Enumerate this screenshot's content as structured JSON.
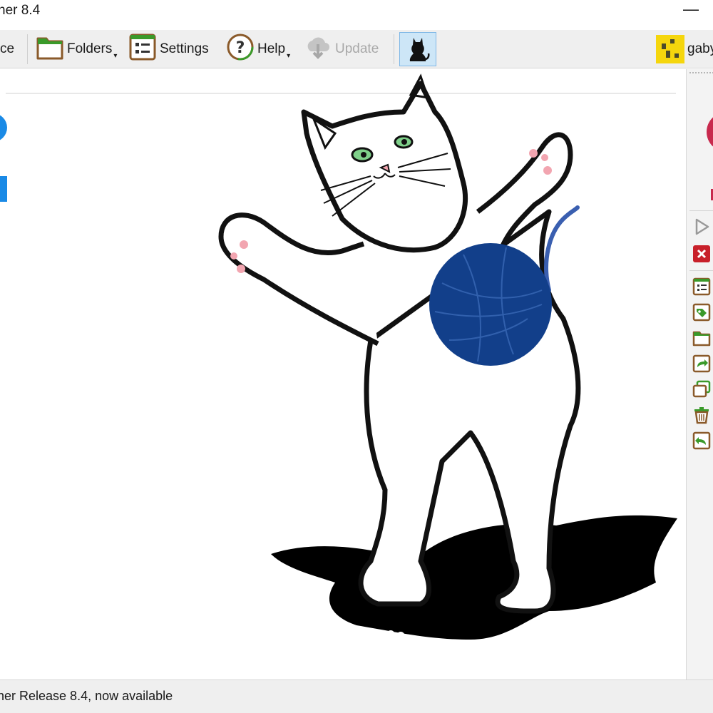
{
  "window": {
    "title": "her 8.4",
    "minimize_glyph": "—"
  },
  "toolbar": {
    "partial_label": "ce",
    "folders_label": "Folders",
    "settings_label": "Settings",
    "help_label": "Help",
    "update_label": "Update",
    "user_label": "gaby",
    "caret": "▾"
  },
  "right_pane": {
    "icons": [
      "play-icon",
      "close-icon",
      "list-icon",
      "tag-icon",
      "folder-icon",
      "share-icon",
      "copy-icon",
      "trash-icon",
      "undo-icon"
    ]
  },
  "status": {
    "text": "her Release 8.4, now available"
  },
  "colors": {
    "accent_blue": "#1a8ae6",
    "yarn_blue": "#123f8a",
    "green_icon": "#3a9a2a",
    "brown_icon": "#8a5a2a",
    "red_circle": "#c8294d"
  }
}
